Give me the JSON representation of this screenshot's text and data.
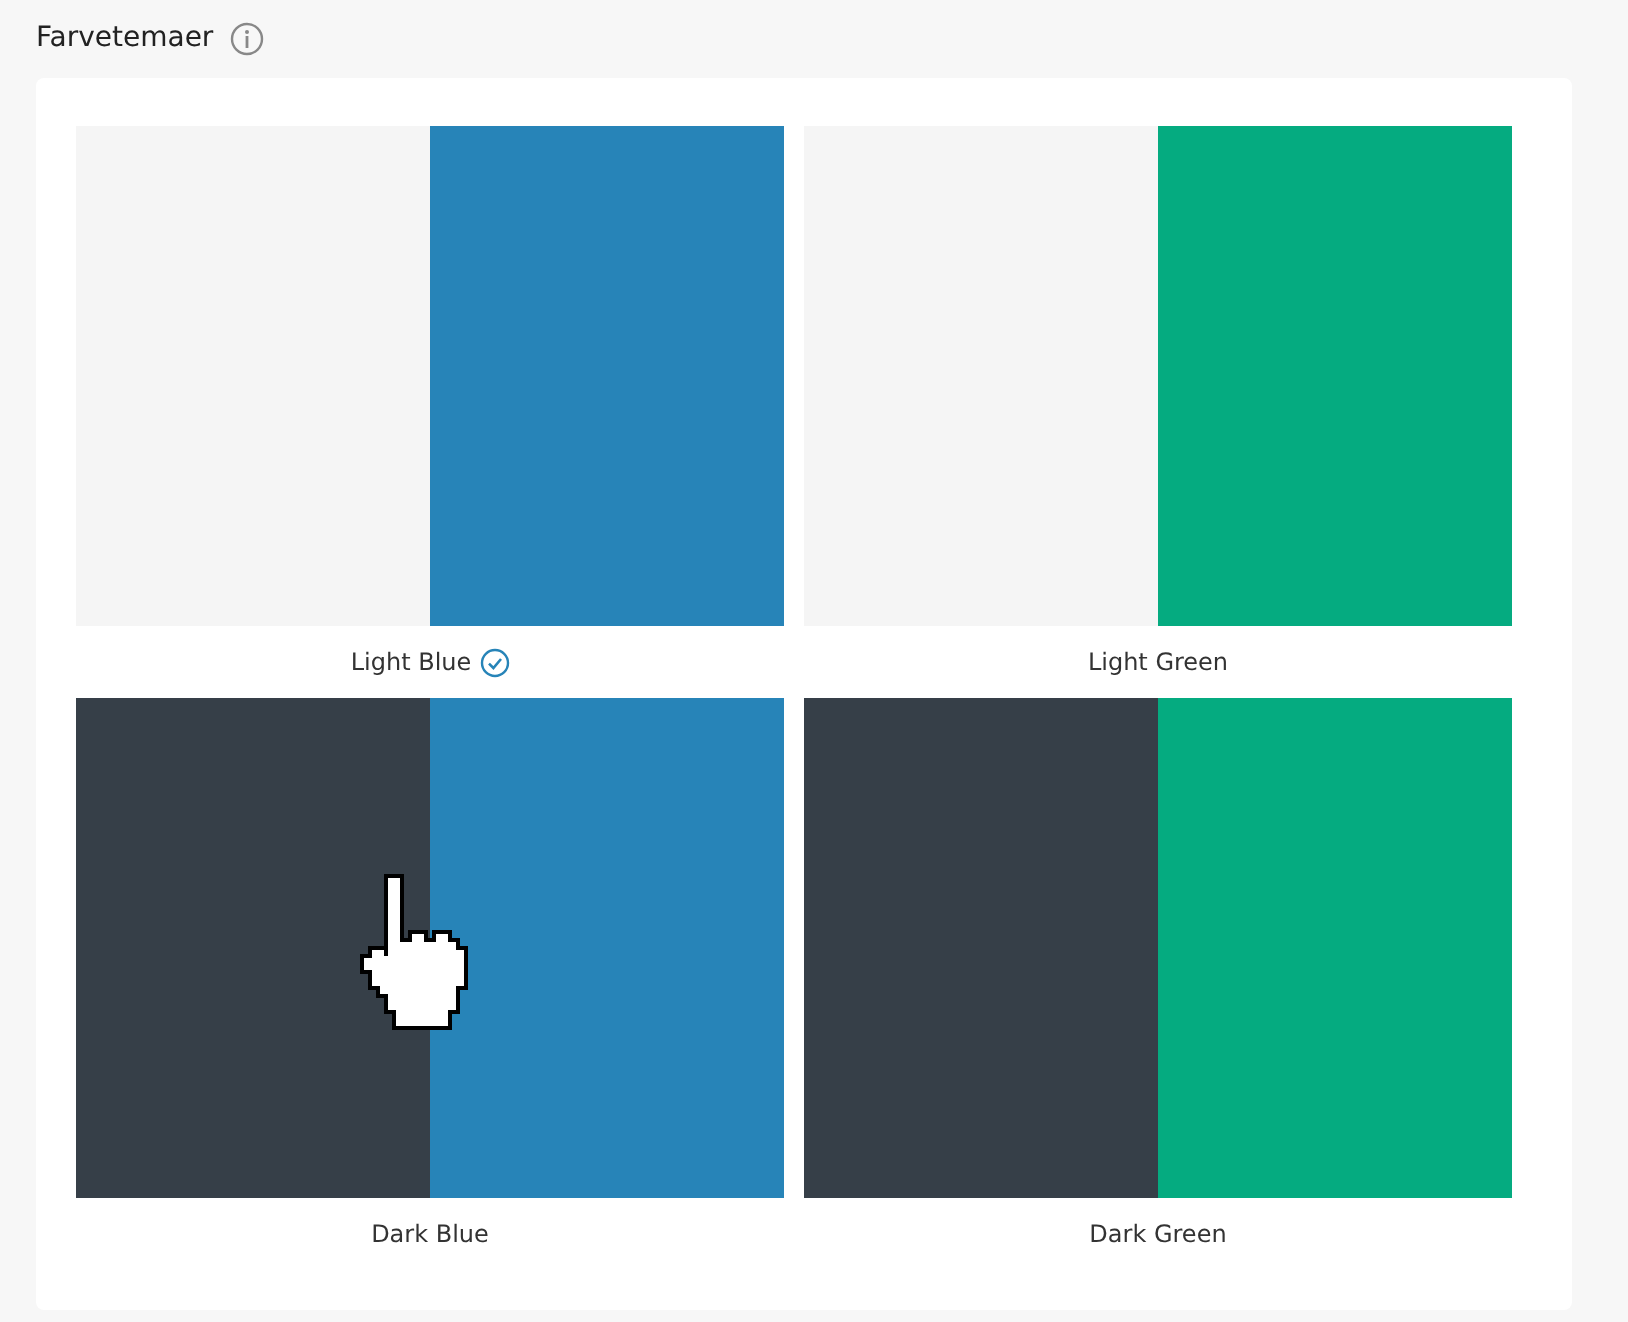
{
  "section": {
    "title": "Farvetemaer"
  },
  "themes": [
    {
      "name": "Light Blue",
      "selected": true,
      "swatch": [
        {
          "color": "#f5f5f5"
        },
        {
          "color": "#2784b8"
        }
      ]
    },
    {
      "name": "Light Green",
      "selected": false,
      "swatch": [
        {
          "color": "#f5f5f5"
        },
        {
          "color": "#05ab80"
        }
      ]
    },
    {
      "name": "Dark Blue",
      "selected": false,
      "swatch": [
        {
          "color": "#363f48"
        },
        {
          "color": "#2784b8"
        }
      ]
    },
    {
      "name": "Dark Green",
      "selected": false,
      "swatch": [
        {
          "color": "#363f48"
        },
        {
          "color": "#05ab80"
        }
      ]
    }
  ]
}
